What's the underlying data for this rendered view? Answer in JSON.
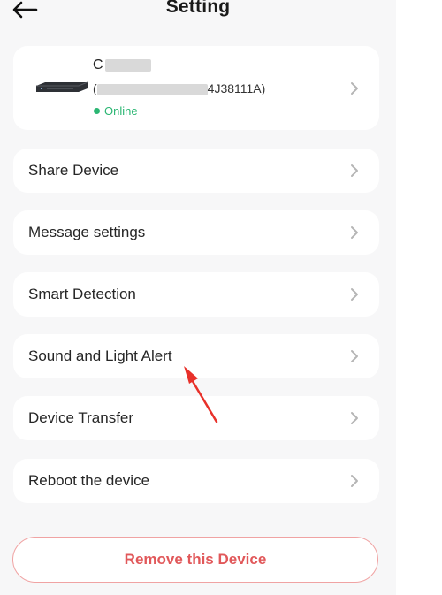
{
  "header": {
    "title": "Setting",
    "back_icon": "arrow-left-icon"
  },
  "device": {
    "name_visible": "C",
    "serial_visible_suffix": "4J38111A)",
    "serial_prefix": "(",
    "status": "Online",
    "status_color": "#2bb673"
  },
  "menu": [
    {
      "label": "Share Device"
    },
    {
      "label": "Message settings"
    },
    {
      "label": "Smart Detection"
    },
    {
      "label": "Sound and Light Alert"
    },
    {
      "label": "Device Transfer"
    },
    {
      "label": "Reboot the device"
    }
  ],
  "remove_button": {
    "label": "Remove this Device",
    "color": "#e1585a"
  },
  "annotation": {
    "type": "arrow",
    "color": "#e8312a",
    "points_to": "Sound and Light Alert"
  }
}
